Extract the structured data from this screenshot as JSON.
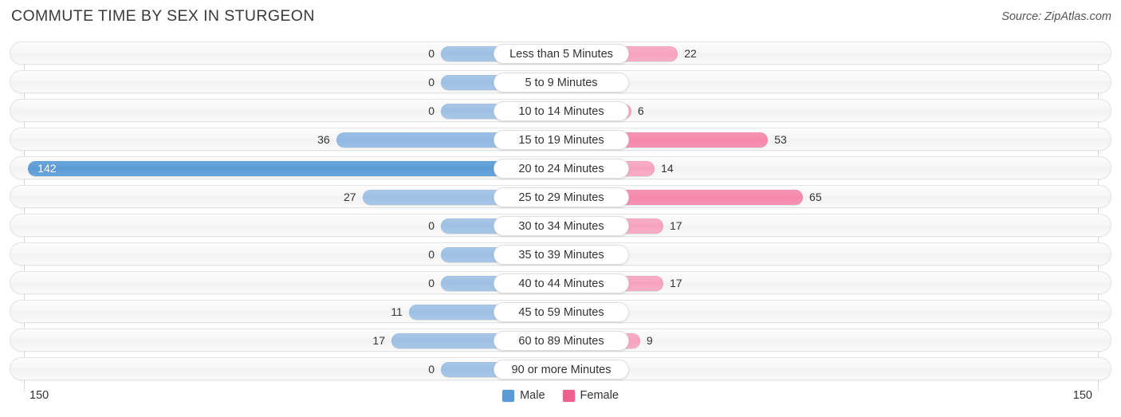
{
  "header": {
    "title": "COMMUTE TIME BY SEX IN STURGEON",
    "source": "Source: ZipAtlas.com"
  },
  "legend": {
    "male_label": "Male",
    "female_label": "Female",
    "male_color": "#5b9bd5",
    "female_color": "#f0608c"
  },
  "axis": {
    "left_label": "150",
    "right_label": "150",
    "max": 150
  },
  "chart_data": {
    "type": "bar",
    "orientation": "horizontal-diverging",
    "title": "COMMUTE TIME BY SEX IN STURGEON",
    "xlabel": "",
    "ylabel": "",
    "xlim": [
      -150,
      150
    ],
    "grid": true,
    "legend_position": "bottom-center",
    "categories": [
      "Less than 5 Minutes",
      "5 to 9 Minutes",
      "10 to 14 Minutes",
      "15 to 19 Minutes",
      "20 to 24 Minutes",
      "25 to 29 Minutes",
      "30 to 34 Minutes",
      "35 to 39 Minutes",
      "40 to 44 Minutes",
      "45 to 59 Minutes",
      "60 to 89 Minutes",
      "90 or more Minutes"
    ],
    "series": [
      {
        "name": "Male",
        "color": "#5b9bd5",
        "side": "left",
        "values": [
          0,
          0,
          0,
          36,
          142,
          27,
          0,
          0,
          0,
          11,
          17,
          0
        ]
      },
      {
        "name": "Female",
        "color": "#f0608c",
        "side": "right",
        "values": [
          22,
          0,
          6,
          53,
          14,
          65,
          17,
          0,
          17,
          0,
          9,
          0
        ]
      }
    ]
  },
  "rows": [
    {
      "label": "Less than 5 Minutes",
      "male": "0",
      "female": "22"
    },
    {
      "label": "5 to 9 Minutes",
      "male": "0",
      "female": "0"
    },
    {
      "label": "10 to 14 Minutes",
      "male": "0",
      "female": "6"
    },
    {
      "label": "15 to 19 Minutes",
      "male": "36",
      "female": "53"
    },
    {
      "label": "20 to 24 Minutes",
      "male": "142",
      "female": "14"
    },
    {
      "label": "25 to 29 Minutes",
      "male": "27",
      "female": "65"
    },
    {
      "label": "30 to 34 Minutes",
      "male": "0",
      "female": "17"
    },
    {
      "label": "35 to 39 Minutes",
      "male": "0",
      "female": "0"
    },
    {
      "label": "40 to 44 Minutes",
      "male": "0",
      "female": "17"
    },
    {
      "label": "45 to 59 Minutes",
      "male": "11",
      "female": "0"
    },
    {
      "label": "60 to 89 Minutes",
      "male": "17",
      "female": "9"
    },
    {
      "label": "90 or more Minutes",
      "male": "0",
      "female": "0"
    }
  ]
}
